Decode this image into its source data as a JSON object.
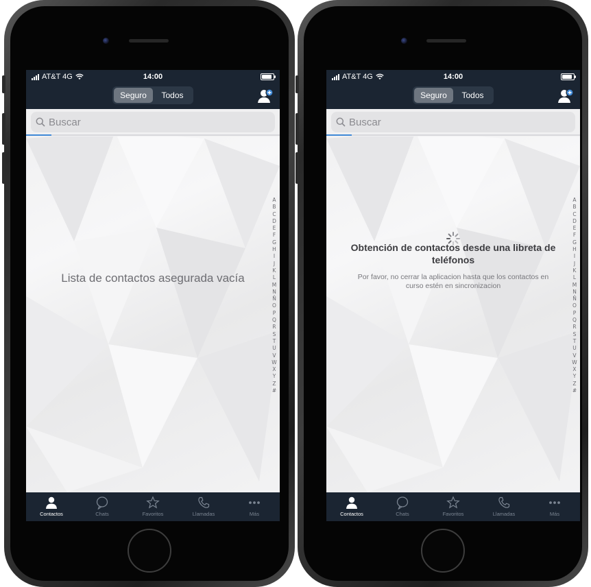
{
  "phones": [
    {
      "status": {
        "carrier": "AT&T 4G",
        "time": "14:00"
      },
      "segments": [
        "Seguro",
        "Todos"
      ],
      "search": {
        "placeholder": "Buscar",
        "value": ""
      },
      "progress": 0.1,
      "empty_message": "Lista de contactos asegurada vacía",
      "tabs": [
        {
          "label": "Contactos",
          "icon": "person-icon",
          "active": true
        },
        {
          "label": "Chats",
          "icon": "chat-bubble-icon",
          "active": false
        },
        {
          "label": "Favoritos",
          "icon": "star-icon",
          "active": false
        },
        {
          "label": "Llamadas",
          "icon": "phone-icon",
          "active": false
        },
        {
          "label": "Más",
          "icon": "more-dots-icon",
          "active": false
        }
      ]
    },
    {
      "status": {
        "carrier": "AT&T 4G",
        "time": "14:00"
      },
      "segments": [
        "Seguro",
        "Todos"
      ],
      "search": {
        "placeholder": "Buscar",
        "value": ""
      },
      "progress": 0.1,
      "loading_title": "Obtención de contactos desde una libreta de teléfonos",
      "loading_subtitle": "Por favor, no cerrar la aplicacion hasta que los contactos en curso estén en sincronizacion",
      "tabs": [
        {
          "label": "Contactos",
          "icon": "person-icon",
          "active": true
        },
        {
          "label": "Chats",
          "icon": "chat-bubble-icon",
          "active": false
        },
        {
          "label": "Favoritos",
          "icon": "star-icon",
          "active": false
        },
        {
          "label": "Llamadas",
          "icon": "phone-icon",
          "active": false
        },
        {
          "label": "Más",
          "icon": "more-dots-icon",
          "active": false
        }
      ]
    }
  ],
  "alphabet_index": [
    "A",
    "B",
    "C",
    "D",
    "E",
    "F",
    "G",
    "H",
    "I",
    "J",
    "K",
    "L",
    "M",
    "N",
    "Ñ",
    "O",
    "P",
    "Q",
    "R",
    "S",
    "T",
    "U",
    "V",
    "W",
    "X",
    "Y",
    "Z",
    "#"
  ],
  "colors": {
    "bar": "#1b2532",
    "accent": "#3f88d6",
    "segment_active": "#6e7680"
  }
}
